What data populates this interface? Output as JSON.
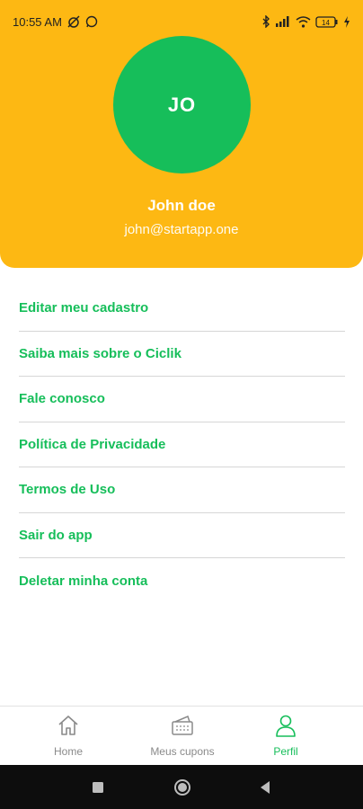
{
  "status_bar": {
    "time": "10:55 AM",
    "left_icons": [
      "alarm-off-icon",
      "whatsapp-icon"
    ],
    "right_icons": [
      "bluetooth-icon",
      "signal-icon",
      "wifi-icon",
      "battery-icon",
      "charging-icon"
    ],
    "battery_level": "14"
  },
  "profile": {
    "initials": "JO",
    "name": "John doe",
    "email": "john@startapp.one"
  },
  "menu": {
    "items": [
      {
        "label": "Editar meu cadastro"
      },
      {
        "label": "Saiba mais sobre o Ciclik"
      },
      {
        "label": "Fale conosco"
      },
      {
        "label": "Política de Privacidade"
      },
      {
        "label": "Termos de Uso"
      },
      {
        "label": "Sair do app"
      },
      {
        "label": "Deletar minha conta"
      }
    ]
  },
  "bottom_nav": {
    "items": [
      {
        "label": "Home",
        "icon": "home-icon"
      },
      {
        "label": "Meus cupons",
        "icon": "coupon-icon"
      },
      {
        "label": "Perfil",
        "icon": "profile-icon"
      }
    ],
    "active": "Perfil"
  },
  "colors": {
    "header_bg": "#FDB813",
    "accent_green": "#16BE5A",
    "nav_inactive": "#8a8a8a"
  }
}
